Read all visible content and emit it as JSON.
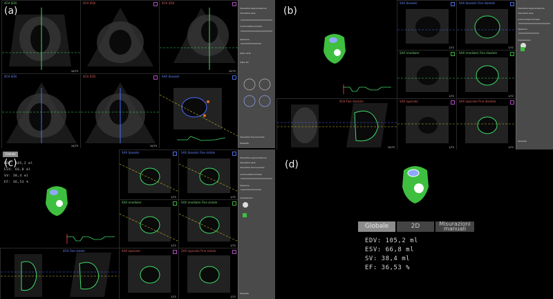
{
  "panels": {
    "a": {
      "label": "(a)",
      "cells": [
        {
          "title": "4CH (ED)",
          "cls": "g",
          "box": "",
          "count": ""
        },
        {
          "title": "4CH (ED)",
          "cls": "r",
          "box": "p",
          "count": ""
        },
        {
          "title": "4CH (ED)",
          "cls": "r",
          "box": "p",
          "count": ""
        },
        {
          "title": "4CH (ED)",
          "cls": "g",
          "box": "",
          "count": ""
        },
        {
          "title": "4CH (ED)",
          "cls": "r",
          "box": "p",
          "count": ""
        },
        {
          "title": "SAX (basale)",
          "cls": "",
          "box": "bl",
          "count": ""
        }
      ],
      "counts": [
        "10/75",
        "10/75",
        "10/75",
        "10/75"
      ]
    },
    "b": {
      "label": "(b)",
      "cells": [
        {
          "title": "SAX (basale)",
          "box": "bl"
        },
        {
          "title": "SAX (basale) Fine diastole",
          "box": "bl"
        },
        {
          "title": "SAX (mediale)",
          "box": "gr"
        },
        {
          "title": "SAX (mediale) Fine diastole",
          "box": "gr"
        },
        {
          "title": "SAX (apicale)",
          "box": "p"
        },
        {
          "title": "SAX (apicale) Fine diastole",
          "box": "p"
        }
      ],
      "long_title": "4CH Fine diastole",
      "counts": [
        "1/72",
        "1/72",
        "1/72",
        "1/72",
        "1/72",
        "1/72",
        "10/75",
        "1/72"
      ]
    },
    "c": {
      "label": "(c)",
      "tab": "Globale",
      "values": [
        "EDV: 105,2 ml",
        "ESV: 66,8 ml",
        "SV: 38,4 ml",
        "EF: 36,53 %"
      ],
      "cells": [
        {
          "title": "SAX (basale)",
          "box": "bl"
        },
        {
          "title": "SAX (basale) Fine sistole",
          "box": "bl"
        },
        {
          "title": "SAX (mediale)",
          "box": "gr"
        },
        {
          "title": "SAX (mediale) Fine sistole",
          "box": "gr"
        },
        {
          "title": "SAX (apicale)",
          "box": "p"
        },
        {
          "title": "SAX (apicale) Fine sistole",
          "box": "p"
        }
      ],
      "long_title": "4CH Fine sistole",
      "counts": [
        "1/72",
        "1/72",
        "1/72",
        "1/72",
        "1/72",
        "1/72"
      ]
    },
    "d": {
      "label": "(d)",
      "tabs": [
        {
          "label": "Globale",
          "active": true
        },
        {
          "label": "2D",
          "active": false
        },
        {
          "label": "Misurazioni manuali",
          "active": false
        }
      ],
      "values": [
        "EDV: 105,2 ml",
        "ESV: 66,8 ml",
        "SV: 38,4 ml",
        "EF: 36,53 %"
      ]
    }
  },
  "sidebar": {
    "rows_a": [
      "Visualizza segmentazione",
      "Visualizza asse",
      "Visualizza tracciamento",
      "Luminosità/Contrasto",
      "Spessore",
      "Valori AHA",
      "Vista 3D",
      "Modalità"
    ],
    "rows_b": [
      "Visualizza segmentazione",
      "Visualizza asse",
      "Luminosità/Contrasto",
      "Spessore",
      "Impostazioni",
      "Modalità"
    ],
    "rows_c": [
      "Visualizza segmentazione",
      "Visualizza asse",
      "Visualizza tracciamento",
      "Luminosità/Contrasto",
      "Spessore",
      "Impostazioni",
      "Modalità"
    ]
  },
  "colors": {
    "heart_green": "#3fbf3f",
    "valve_blue": "#8fa8ff",
    "valve_white": "#ffffff",
    "tab_active": "#8c8c8c",
    "tab_inactive": "#444444",
    "contour_green": "#3fdc6a",
    "axis_blue": "#4a6cff",
    "axis_yellow": "#c8c030"
  }
}
